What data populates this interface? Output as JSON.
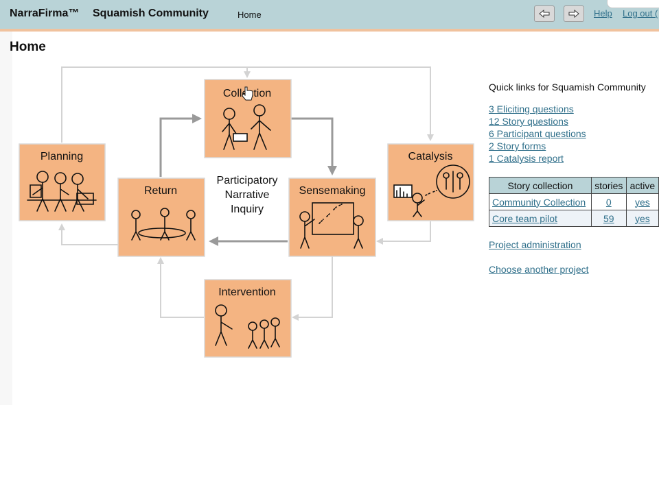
{
  "header": {
    "app_name": "NarraFirma™",
    "project_name": "Squamish Community",
    "nav_home": "Home",
    "back_icon": "left-arrow-icon",
    "forward_icon": "right-arrow-icon",
    "help_label": "Help",
    "logout_label": "Log out ("
  },
  "page": {
    "title": "Home"
  },
  "diagram": {
    "center_title_lines": [
      "Participatory",
      "Narrative",
      "Inquiry"
    ],
    "boxes": {
      "collection": "Collection",
      "planning": "Planning",
      "catalysis": "Catalysis",
      "return": "Return",
      "sensemaking": "Sensemaking",
      "intervention": "Intervention"
    }
  },
  "quick_links": {
    "title": "Quick links for Squamish Community",
    "links": [
      "3 Eliciting questions",
      "12 Story questions",
      "6 Participant questions",
      "2 Story forms",
      "1 Catalysis report"
    ]
  },
  "story_table": {
    "headers": [
      "Story collection",
      "stories",
      "active"
    ],
    "rows": [
      [
        "Community Collection",
        "0",
        "yes"
      ],
      [
        "Core team pilot",
        "59",
        "yes"
      ]
    ]
  },
  "bottom_links": {
    "project_admin": "Project administration",
    "choose_project": "Choose another project"
  },
  "colors": {
    "header_bg": "#b9d3d7",
    "header_stripe": "#f0c29e",
    "box_fill": "#f4b482",
    "link": "#2f6f8a"
  }
}
